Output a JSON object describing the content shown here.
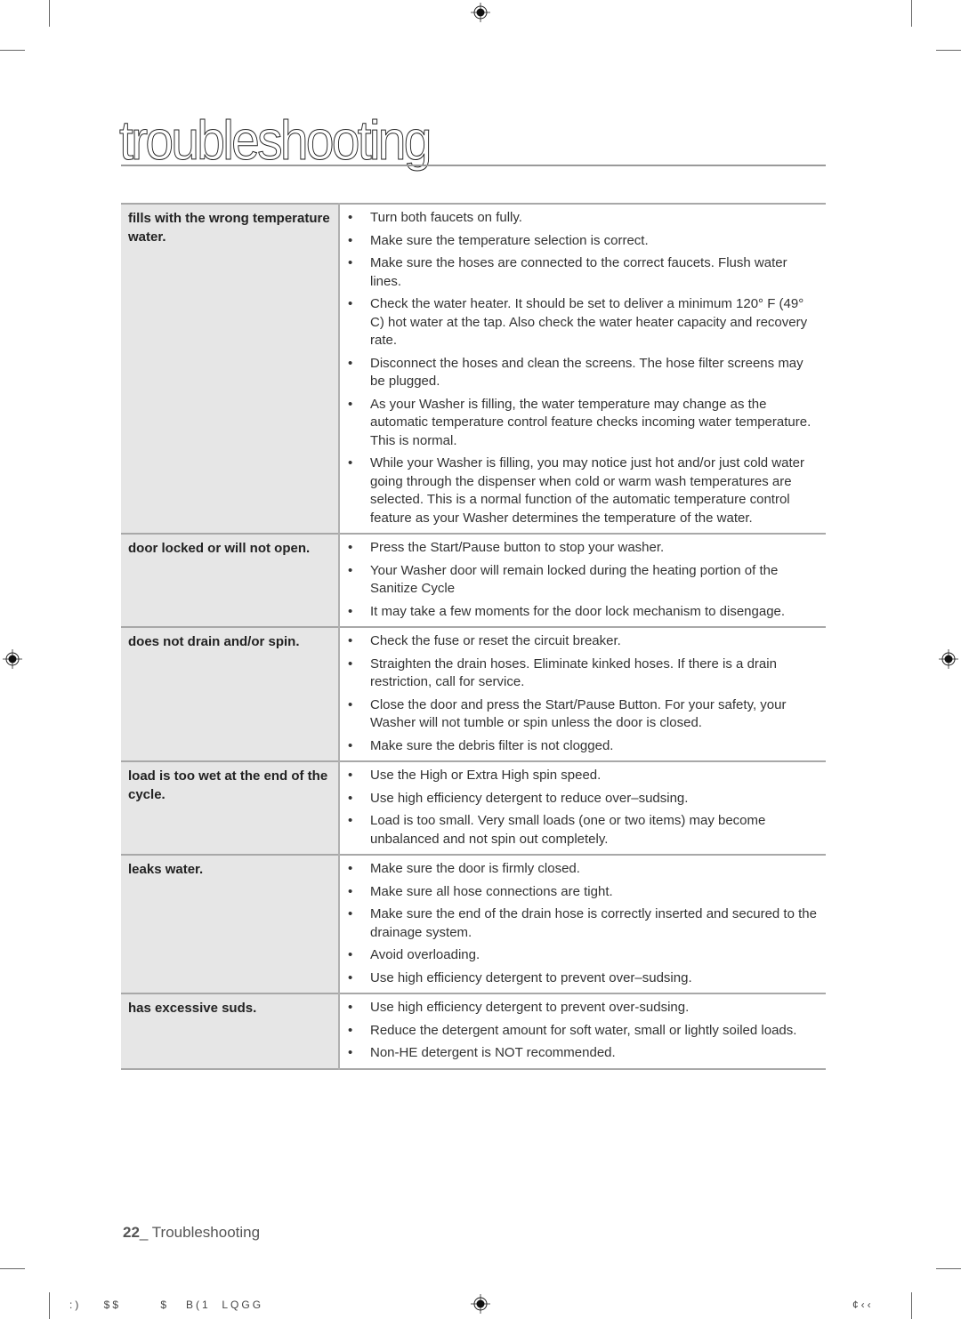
{
  "page": {
    "title": "troubleshooting",
    "footer": {
      "page_number": "22",
      "separator": "_ ",
      "section": "Troubleshooting"
    },
    "imprint": {
      "left": ":)    $$       $   B(1  LQGG",
      "right": "¢‹‹"
    }
  },
  "table": {
    "rows": [
      {
        "problem": "fills with the wrong temperature water.",
        "solutions": [
          "Turn both faucets on fully.",
          "Make sure the temperature selection is correct.",
          "Make sure the hoses are connected to the correct faucets. Flush water lines.",
          "Check the water heater. It should be set to deliver a minimum 120° F (49° C) hot water at the tap. Also check the water heater capacity and recovery rate.",
          "Disconnect the hoses and clean the screens. The hose filter screens may be plugged.",
          "As your Washer is filling, the water temperature may change as the automatic temperature control feature checks incoming water temperature. This is normal.",
          "While your Washer is filling, you may notice just hot and/or just cold water going through the dispenser when cold or warm wash temperatures are selected. This is a normal function of the automatic temperature control feature as your Washer determines the temperature of the water."
        ]
      },
      {
        "problem": "door locked or will not open.",
        "solutions": [
          "Press the Start/Pause button to stop your washer.",
          "Your Washer door will remain locked during the heating portion of the Sanitize Cycle",
          "It may take a few moments for the door lock mechanism to disengage."
        ]
      },
      {
        "problem": "does not drain and/or spin.",
        "solutions": [
          "Check the fuse or reset the circuit breaker.",
          "Straighten the drain hoses. Eliminate kinked hoses. If there is a drain restriction, call for service.",
          "Close the door and press the Start/Pause Button. For your safety, your Washer will not tumble or spin unless the door is closed.",
          "Make sure the debris filter is not clogged."
        ]
      },
      {
        "problem": "load is too wet at the end of the cycle.",
        "solutions": [
          "Use the High or Extra High spin speed.",
          "Use high efficiency detergent to reduce over–sudsing.",
          "Load is too small. Very small loads (one or two items) may become unbalanced and not spin out completely."
        ]
      },
      {
        "problem": "leaks water.",
        "solutions": [
          "Make sure the door is firmly closed.",
          "Make sure all hose connections are tight.",
          "Make sure the end of the drain hose is correctly inserted and secured to the drainage system.",
          "Avoid overloading.",
          "Use high efficiency detergent to prevent over–sudsing."
        ]
      },
      {
        "problem": "has excessive suds.",
        "solutions": [
          "Use high efficiency detergent to prevent over-sudsing.",
          "Reduce the detergent amount for soft water, small or lightly soiled loads.",
          "Non-HE detergent is NOT recommended."
        ]
      }
    ]
  },
  "icons": {
    "registration_mark": "registration-mark-icon",
    "bullet": "•"
  }
}
